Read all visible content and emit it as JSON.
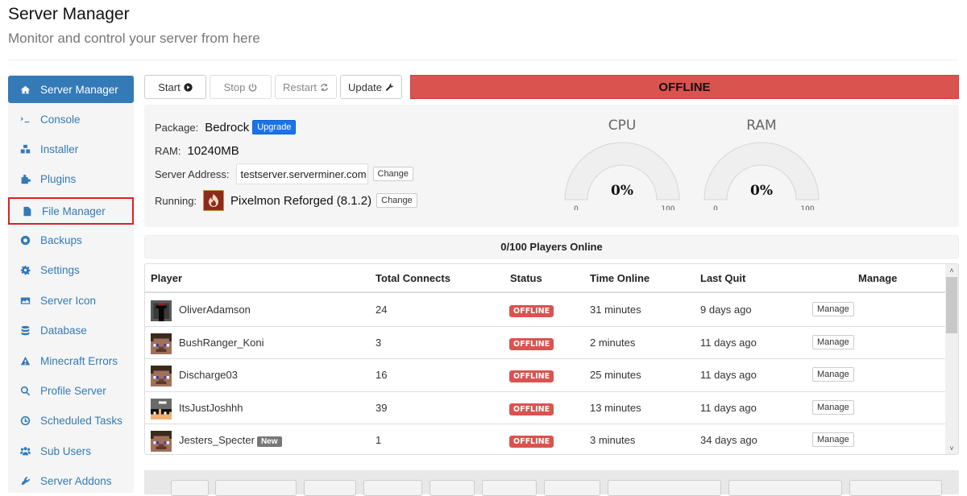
{
  "header": {
    "title": "Server Manager",
    "subtitle": "Monitor and control your server from here"
  },
  "sidebar": {
    "items": [
      {
        "label": "Server Manager",
        "icon": "home-icon",
        "active": true
      },
      {
        "label": "Console",
        "icon": "terminal-icon"
      },
      {
        "label": "Installer",
        "icon": "cubes-icon"
      },
      {
        "label": "Plugins",
        "icon": "puzzle-icon"
      },
      {
        "label": "File Manager",
        "icon": "file-icon",
        "highlighted": true
      },
      {
        "label": "Backups",
        "icon": "lifebuoy-icon"
      },
      {
        "label": "Settings",
        "icon": "gear-icon"
      },
      {
        "label": "Server Icon",
        "icon": "image-icon"
      },
      {
        "label": "Database",
        "icon": "database-icon"
      },
      {
        "label": "Minecraft Errors",
        "icon": "warning-icon"
      },
      {
        "label": "Profile Server",
        "icon": "search-icon"
      },
      {
        "label": "Scheduled Tasks",
        "icon": "clock-icon"
      },
      {
        "label": "Sub Users",
        "icon": "users-icon"
      },
      {
        "label": "Server Addons",
        "icon": "plug-icon"
      }
    ]
  },
  "toolbar": {
    "start_label": "Start",
    "stop_label": "Stop",
    "restart_label": "Restart",
    "update_label": "Update",
    "status": "OFFLINE",
    "status_color": "#d9534f"
  },
  "info": {
    "package_label": "Package:",
    "package_value": "Bedrock",
    "upgrade_label": "Upgrade",
    "ram_label": "RAM:",
    "ram_value": "10240MB",
    "address_label": "Server Address:",
    "address_value": "testserver.serverminer.com",
    "change_label": "Change",
    "running_label": "Running:",
    "running_value": "Pixelmon Reforged (8.1.2)",
    "running_change_label": "Change"
  },
  "gauges": {
    "cpu": {
      "title": "CPU",
      "value": 0,
      "display": "0%",
      "min": "0",
      "max": "100"
    },
    "ram": {
      "title": "RAM",
      "value": 0,
      "display": "0%",
      "min": "0",
      "max": "100"
    }
  },
  "players": {
    "summary": "0/100 Players Online",
    "columns": [
      "Player",
      "Total Connects",
      "Status",
      "Time Online",
      "Last Quit",
      "Manage"
    ],
    "rows": [
      {
        "name": "OliverAdamson",
        "connects": "24",
        "status": "OFFLINE",
        "time_online": "31 minutes",
        "last_quit": "9 days ago",
        "manage": "Manage",
        "skin": "dark"
      },
      {
        "name": "BushRanger_Koni",
        "connects": "3",
        "status": "OFFLINE",
        "time_online": "2 minutes",
        "last_quit": "11 days ago",
        "manage": "Manage",
        "skin": "steve"
      },
      {
        "name": "Discharge03",
        "connects": "16",
        "status": "OFFLINE",
        "time_online": "25 minutes",
        "last_quit": "11 days ago",
        "manage": "Manage",
        "skin": "steve"
      },
      {
        "name": "ItsJustJoshhh",
        "connects": "39",
        "status": "OFFLINE",
        "time_online": "13 minutes",
        "last_quit": "11 days ago",
        "manage": "Manage",
        "skin": "josh"
      },
      {
        "name": "Jesters_Specter",
        "badge": "New",
        "connects": "1",
        "status": "OFFLINE",
        "time_online": "3 minutes",
        "last_quit": "34 days ago",
        "manage": "Manage",
        "skin": "steve"
      }
    ]
  },
  "scroll": {
    "up": "˄",
    "down": "˅"
  }
}
